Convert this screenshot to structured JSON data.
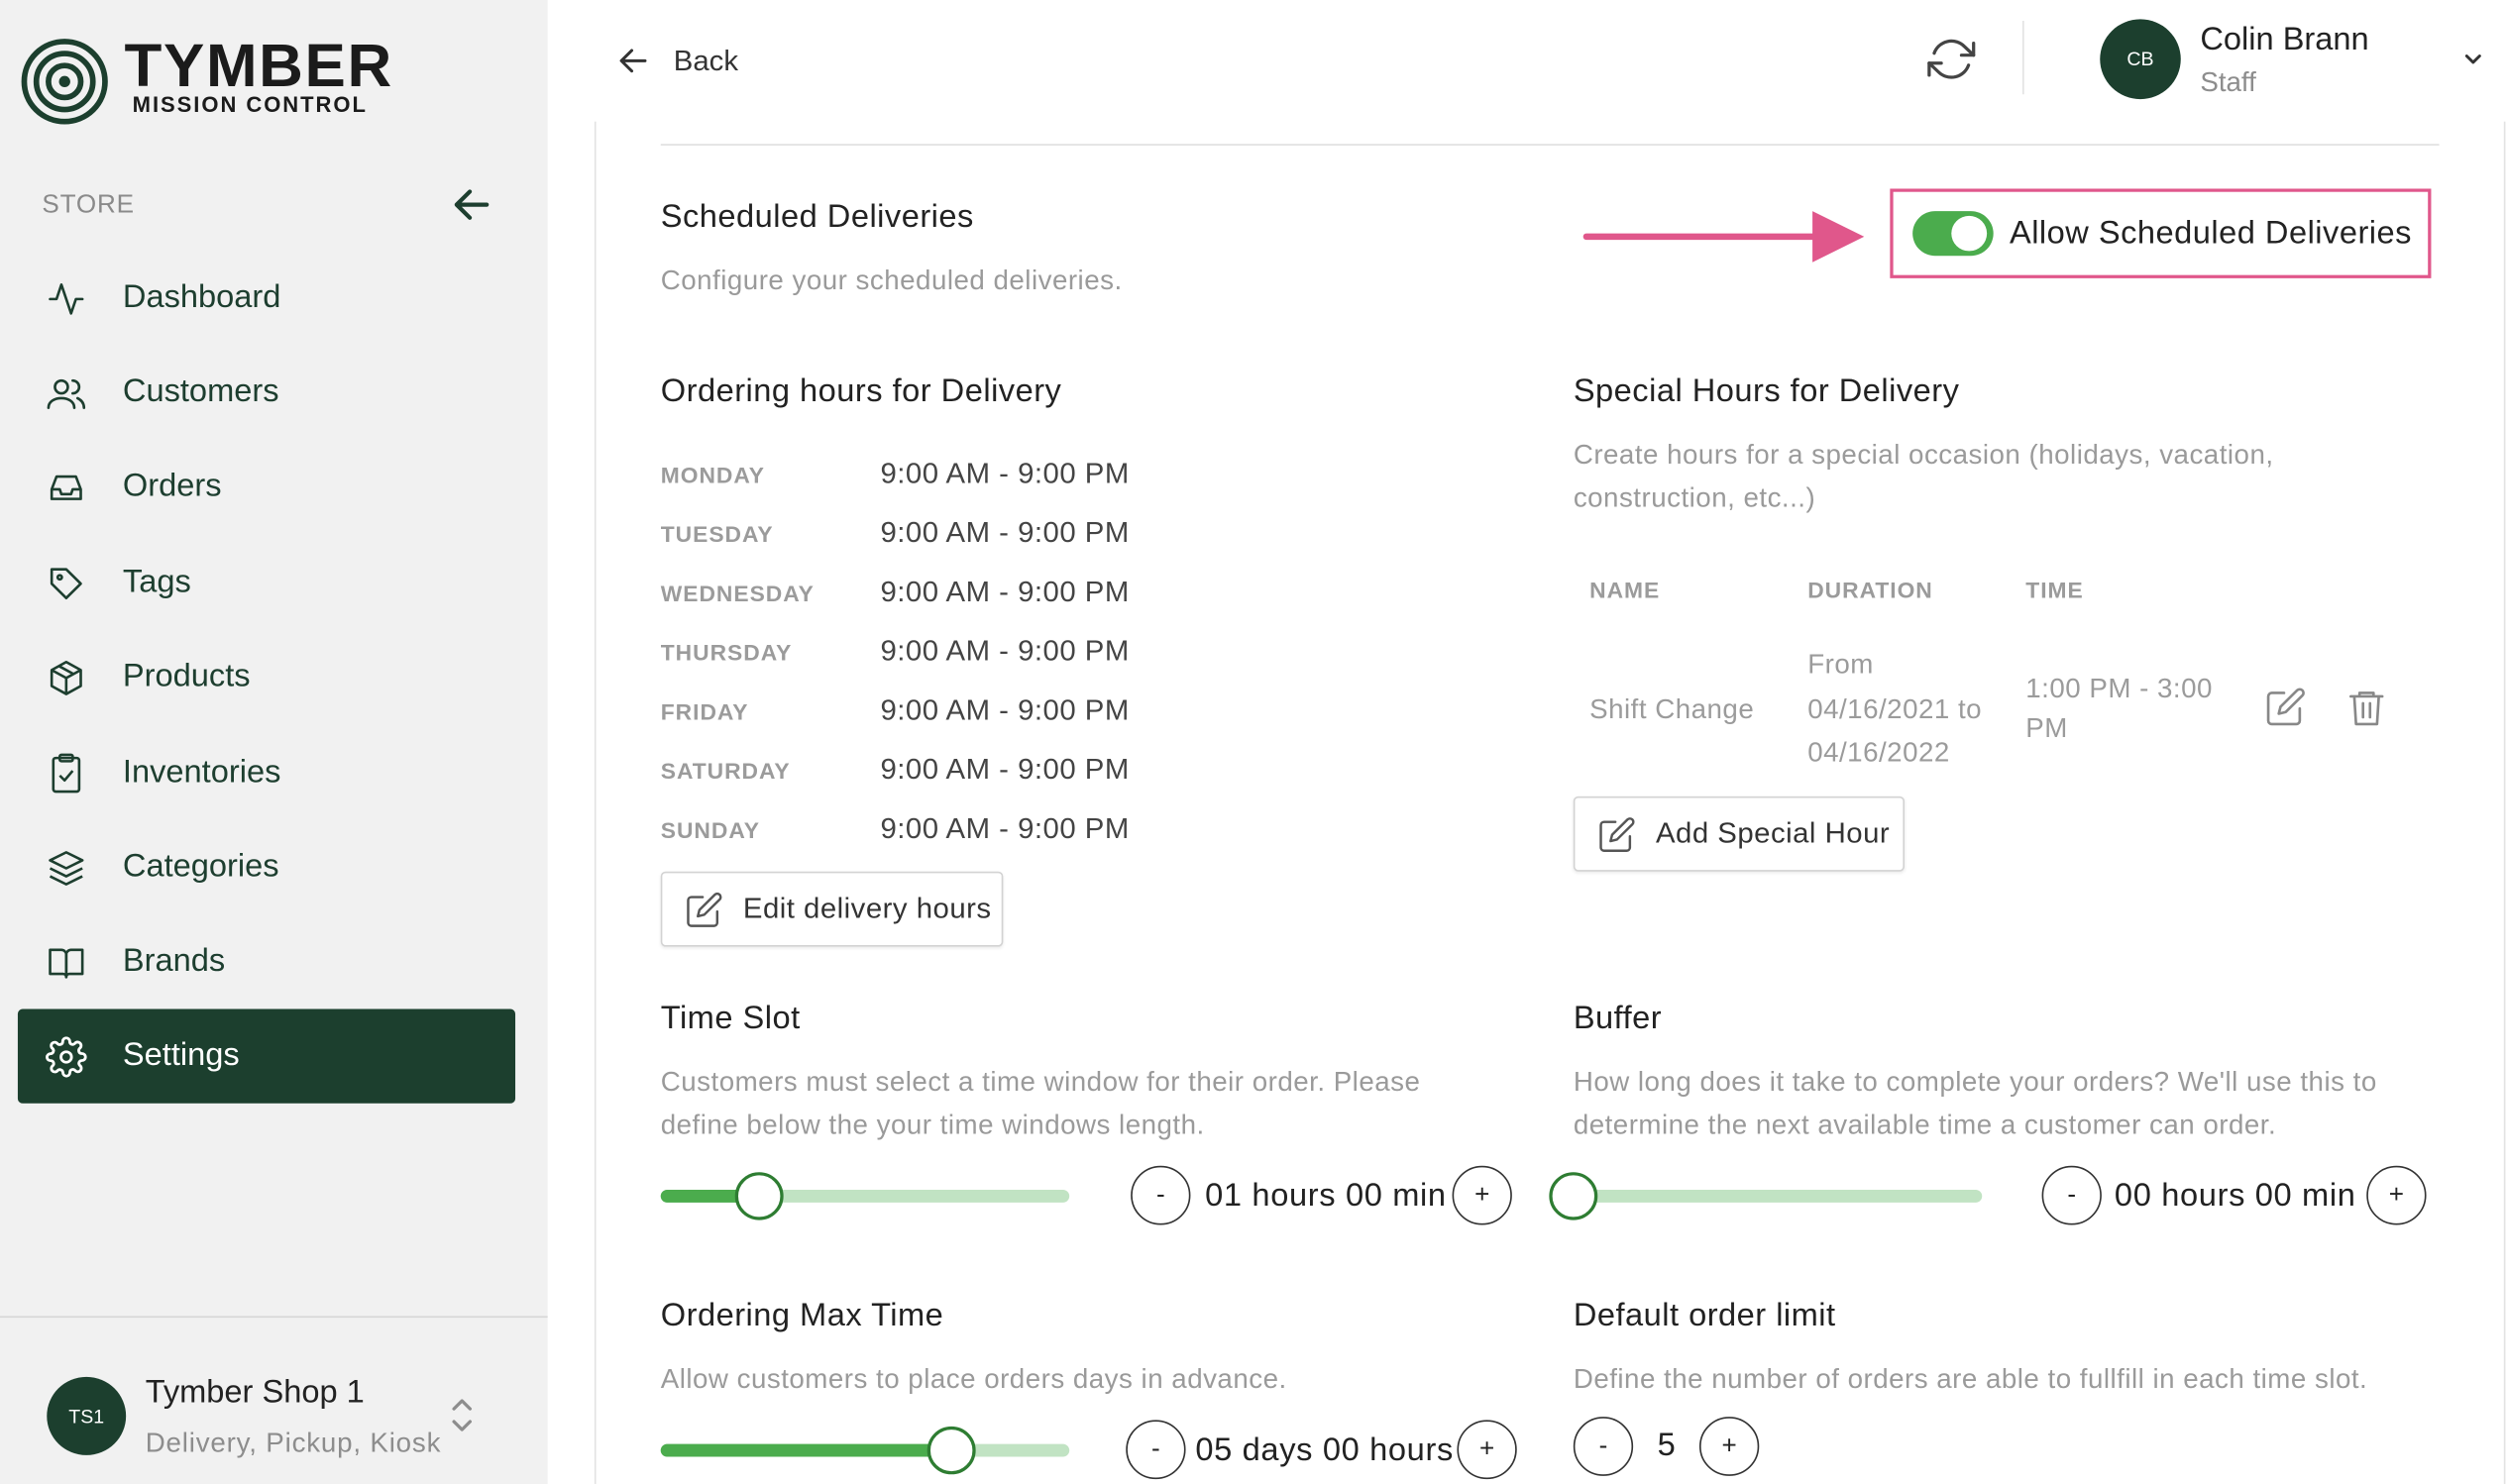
{
  "brand": {
    "title": "TYMBER",
    "subtitle": "MISSION CONTROL"
  },
  "sidebar": {
    "section_label": "STORE",
    "items": [
      {
        "label": "Dashboard",
        "icon": "activity-icon"
      },
      {
        "label": "Customers",
        "icon": "users-icon"
      },
      {
        "label": "Orders",
        "icon": "inbox-icon"
      },
      {
        "label": "Tags",
        "icon": "tag-icon"
      },
      {
        "label": "Products",
        "icon": "package-icon"
      },
      {
        "label": "Inventories",
        "icon": "clipboard-icon"
      },
      {
        "label": "Categories",
        "icon": "layers-icon"
      },
      {
        "label": "Brands",
        "icon": "book-icon"
      },
      {
        "label": "Settings",
        "icon": "settings-icon",
        "active": true
      }
    ],
    "shop": {
      "initials": "TS1",
      "name": "Tymber Shop 1",
      "modes": "Delivery, Pickup, Kiosk"
    }
  },
  "header": {
    "back_label": "Back",
    "user": {
      "initials": "CB",
      "name": "Colin Brann",
      "role": "Staff"
    }
  },
  "scheduled": {
    "title": "Scheduled Deliveries",
    "description": "Configure your scheduled deliveries.",
    "toggle_label": "Allow Scheduled Deliveries",
    "toggle_on": true,
    "highlight_color": "#e0578b"
  },
  "ordering_hours": {
    "title": "Ordering hours for Delivery",
    "days": [
      {
        "day": "MONDAY",
        "hours": "9:00 AM - 9:00 PM"
      },
      {
        "day": "TUESDAY",
        "hours": "9:00 AM - 9:00 PM"
      },
      {
        "day": "WEDNESDAY",
        "hours": "9:00 AM - 9:00 PM"
      },
      {
        "day": "THURSDAY",
        "hours": "9:00 AM - 9:00 PM"
      },
      {
        "day": "FRIDAY",
        "hours": "9:00 AM - 9:00 PM"
      },
      {
        "day": "SATURDAY",
        "hours": "9:00 AM - 9:00 PM"
      },
      {
        "day": "SUNDAY",
        "hours": "9:00 AM - 9:00 PM"
      }
    ],
    "edit_button": "Edit delivery hours"
  },
  "special_hours": {
    "title": "Special Hours for Delivery",
    "description_line1": "Create hours for a special occasion (holidays, vacation,",
    "description_line2": "construction, etc...)",
    "columns": [
      "NAME",
      "DURATION",
      "TIME"
    ],
    "rows": [
      {
        "name": "Shift Change",
        "duration_l1": "From",
        "duration_l2": "04/16/2021 to",
        "duration_l3": "04/16/2022",
        "time_l1": "1:00 PM - 3:00",
        "time_l2": "PM"
      }
    ],
    "add_button": "Add Special Hour"
  },
  "time_slot": {
    "title": "Time Slot",
    "description_line1": "Customers must select a time window for their order. Please",
    "description_line2": "define below the your time windows length.",
    "value": "01 hours 00 min",
    "slider_fraction": 0.24
  },
  "buffer": {
    "title": "Buffer",
    "description_line1": "How long does it take to complete your orders? We'll use this to",
    "description_line2": "determine the next available time a customer can order.",
    "value": "00 hours 00 min",
    "slider_fraction": 0
  },
  "ordering_max": {
    "title": "Ordering Max Time",
    "description": "Allow customers to place orders days in advance.",
    "value": "05 days 00 hours",
    "slider_fraction": 0.71
  },
  "order_limit": {
    "title": "Default order limit",
    "description": "Define the number of orders are able to fullfill in each time slot.",
    "value": "5"
  },
  "stepper": {
    "minus": "-",
    "plus": "+"
  },
  "colors": {
    "brand_green": "#1c3f2e",
    "accent_green": "#4bac4d",
    "track_green": "#c1e3c3"
  }
}
